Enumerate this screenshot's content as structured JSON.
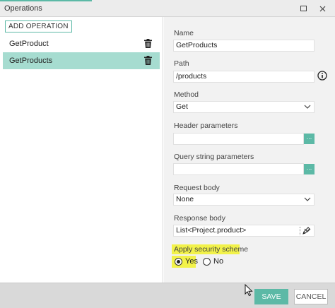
{
  "window": {
    "title": "Operations"
  },
  "toolbar": {
    "add_operation_label": "ADD OPERATION"
  },
  "operations": [
    {
      "label": "GetProduct",
      "selected": false,
      "icon": "trash-icon"
    },
    {
      "label": "GetProducts",
      "selected": true,
      "icon": "trash-icon"
    }
  ],
  "form": {
    "name_label": "Name",
    "name_value": "GetProducts",
    "path_label": "Path",
    "path_value": "/products",
    "method_label": "Method",
    "method_value": "Get",
    "header_params_label": "Header parameters",
    "header_params_value": "",
    "header_params_button": "...",
    "query_params_label": "Query string parameters",
    "query_params_value": "",
    "query_params_button": "...",
    "request_body_label": "Request body",
    "request_body_value": "None",
    "response_body_label": "Response body",
    "response_body_value": "List<Project.product>",
    "security_label": "Apply security scheme",
    "security_options": [
      {
        "label": "Yes",
        "selected": true
      },
      {
        "label": "No",
        "selected": false
      }
    ]
  },
  "footer": {
    "save_label": "SAVE",
    "cancel_label": "CANCEL"
  },
  "colors": {
    "accent": "#5cb9a6",
    "selected_row": "#a6dcd0",
    "highlight": "#f2f24a"
  }
}
